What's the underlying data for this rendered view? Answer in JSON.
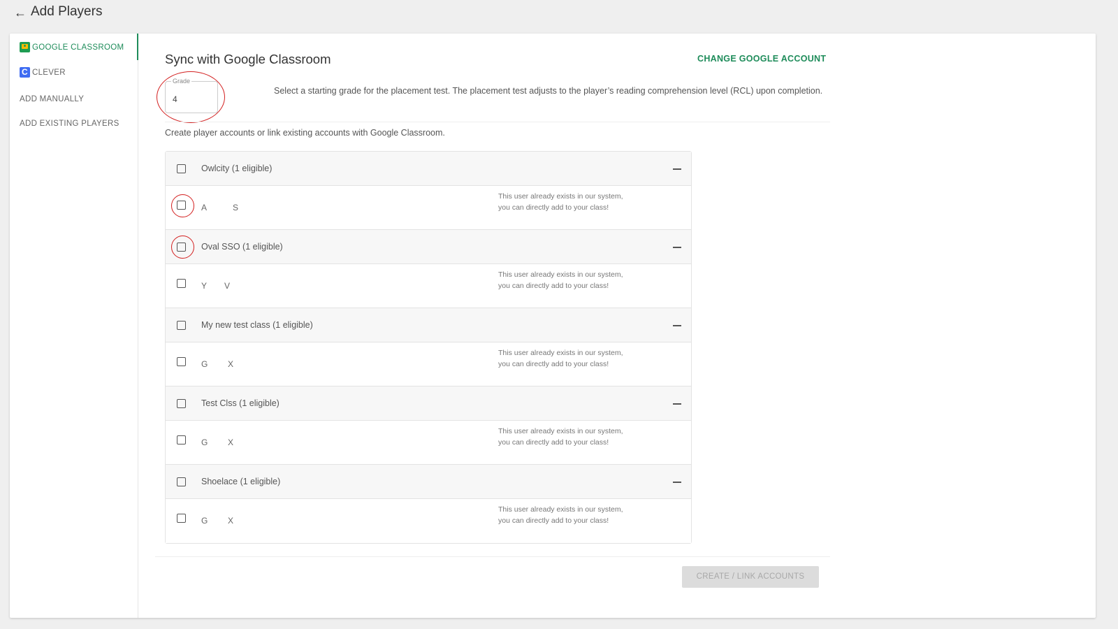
{
  "header": {
    "back_icon": "arrow-left-icon",
    "title": "Add Players"
  },
  "sidebar": {
    "items": [
      {
        "label": "GOOGLE CLASSROOM",
        "icon": "google-classroom-icon",
        "active": true
      },
      {
        "label": "CLEVER",
        "icon": "clever-icon",
        "active": false
      },
      {
        "label": "ADD MANUALLY",
        "active": false
      },
      {
        "label": "ADD EXISTING PLAYERS",
        "active": false
      }
    ]
  },
  "main": {
    "title": "Sync with Google Classroom",
    "change_account": "CHANGE GOOGLE ACCOUNT",
    "grade": {
      "label": "Grade",
      "value": "4"
    },
    "grade_description": "Select a starting grade for the placement test. The placement test adjusts to the player’s reading comprehension level (RCL) upon completion.",
    "create_description": "Create player accounts or link existing accounts with Google Classroom.",
    "collapse_icon": "minus-icon",
    "classes": [
      {
        "name": "Owlcity (1 eligible)",
        "student": {
          "first": "A",
          "last": "S",
          "note": "This user already exists in our system, you can directly add to your class!"
        }
      },
      {
        "name": "Oval SSO (1 eligible)",
        "student": {
          "first": "Y",
          "last": "V",
          "note": "This user already exists in our system, you can directly add to your class!"
        }
      },
      {
        "name": "My new test class (1 eligible)",
        "student": {
          "first": "G",
          "last": "X",
          "note": "This user already exists in our system, you can directly add to your class!"
        }
      },
      {
        "name": "Test Clss (1 eligible)",
        "student": {
          "first": "G",
          "last": "X",
          "note": "This user already exists in our system, you can directly add to your class!"
        }
      },
      {
        "name": "Shoelace (1 eligible)",
        "student": {
          "first": "G",
          "last": "X",
          "note": "This user already exists in our system, you can directly add to your class!"
        }
      }
    ],
    "submit_label": "CREATE / LINK ACCOUNTS"
  },
  "colors": {
    "accent": "#1e8c5a",
    "annotation": "#d32020",
    "disabled_button": "#dcdcdc"
  }
}
